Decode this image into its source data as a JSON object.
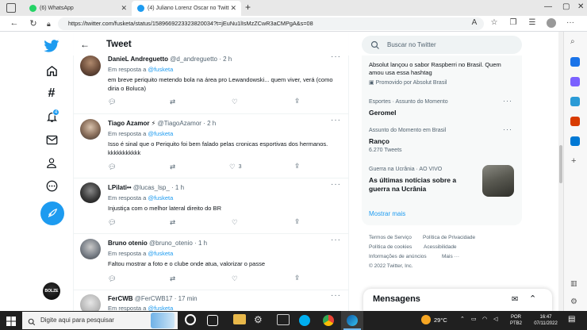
{
  "browser": {
    "tabs": [
      {
        "label": "(6) WhatsApp",
        "icon": "whatsapp-icon",
        "color": "#25d366"
      },
      {
        "label": "(4) Juliano Lorenz Oscar no Twitt",
        "icon": "twitter-icon",
        "color": "#1d9bf0"
      }
    ],
    "url": "https://twitter.com/fusketa/status/1589669223323820034?t=jEuNu1lIsMzZCwR3aCMPgA&s=08"
  },
  "header": {
    "title": "Tweet"
  },
  "tweets": [
    {
      "name": "DanieL Andreguetto",
      "handle": "@d_andreguetto",
      "time": "2 h",
      "reply_prefix": "Em resposta a",
      "reply_to": "@fusketa",
      "text": "em breve periquito metendo bola na área pro Lewandowski... quem viver, verá (como diria o Boluca)",
      "likes": ""
    },
    {
      "name": "Tiago Azamor ⚡",
      "handle": "@TiagoAzamor",
      "time": "2 h",
      "reply_prefix": "Em resposta a",
      "reply_to": "@fusketa",
      "text": "Isso é sinal que o Periquito foi bem falado pelas cronicas esportivas dos hermanos. kkkkkkkkkkk",
      "likes": "3"
    },
    {
      "name": "LPilati••",
      "handle": "@lucas_lsp_",
      "time": "1 h",
      "reply_prefix": "Em resposta a",
      "reply_to": "@fusketa",
      "text": "Injustiça com o melhor lateral direito do BR",
      "likes": ""
    },
    {
      "name": "Bruno otenio",
      "handle": "@bruno_otenio",
      "time": "1 h",
      "reply_prefix": "Em resposta a",
      "reply_to": "@fusketa",
      "text": "Faltou mostrar a foto e o clube onde atua, valorizar o passe",
      "likes": ""
    },
    {
      "name": "FerCWB",
      "handle": "@FerCWB17",
      "time": "17 min",
      "reply_prefix": "Em resposta a",
      "reply_to": "@fusketa",
      "text": "",
      "likes": ""
    }
  ],
  "sidebar": {
    "search_placeholder": "Buscar no Twitter",
    "promo_text": "Absolut lançou o sabor Raspberri no Brasil. Quem amou usa essa hashtag",
    "promo_by": "Promovido por Absolut Brasil",
    "trends": [
      {
        "context": "Esportes · Assunto do Momento",
        "title": "Geromel",
        "count": ""
      },
      {
        "context": "Assunto do Momento em Brasil",
        "title": "Ranço",
        "count": "6.270 Tweets"
      },
      {
        "context": "Guerra na Ucrânia · AO VIVO",
        "title": "As últimas notícias sobre a guerra na Ucrânia",
        "count": ""
      }
    ],
    "show_more": "Mostrar mais",
    "footer": [
      "Termos de Serviço",
      "Política de Privacidade",
      "Política de cookies",
      "Acessibilidade",
      "Informações de anúncios",
      "Mais ···",
      "© 2022 Twitter, Inc."
    ],
    "messages_title": "Mensagens"
  },
  "nav": {
    "notif_count": "4",
    "user_avatar_text": "BOLZE"
  },
  "taskbar": {
    "search_placeholder": "Digite aqui para pesquisar",
    "weather": "29°C",
    "lang": "POR",
    "kbd": "PTB2",
    "time": "16:47",
    "date": "07/11/2022"
  },
  "colors": {
    "accent": "#1d9bf0",
    "text": "#0f1419",
    "muted": "#536471"
  }
}
